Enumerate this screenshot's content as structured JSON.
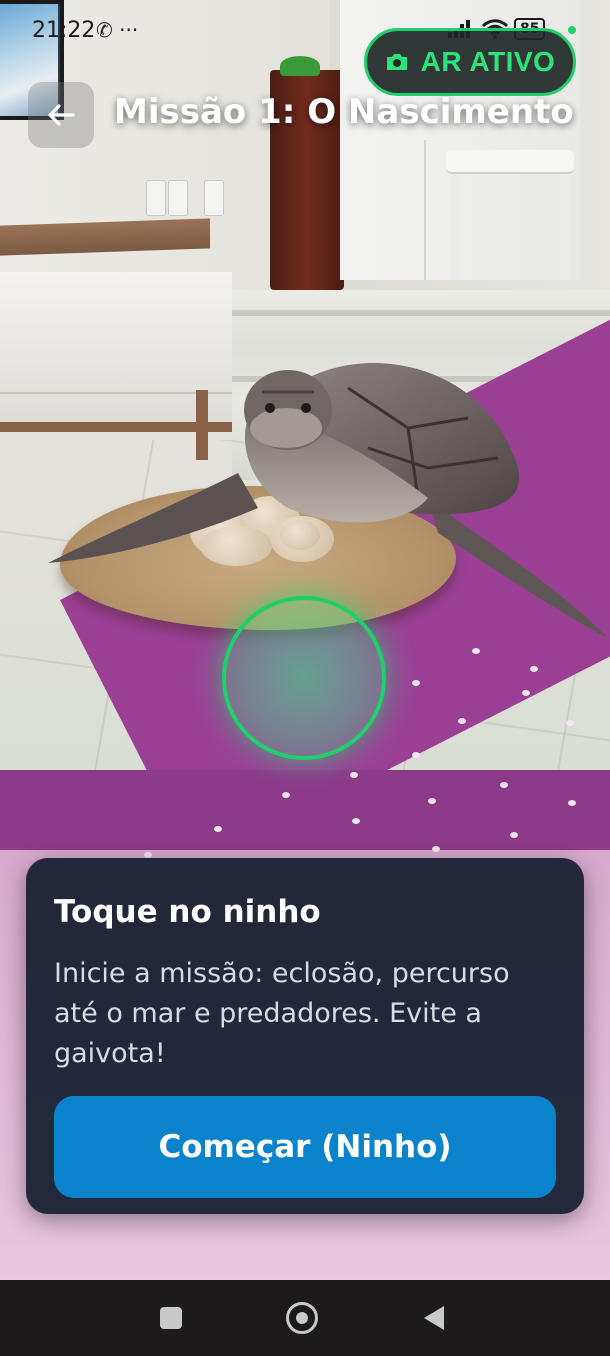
{
  "status_bar": {
    "time": "21:22",
    "left_icons": "✆ ···",
    "battery": "85"
  },
  "ar_badge": {
    "label": "AR ATIVO",
    "color": "#1fd06a",
    "icon": "camera-icon"
  },
  "header": {
    "title": "Missão 1: O Nascimento",
    "back_icon": "arrow-left-icon"
  },
  "mission_card": {
    "title": "Toque no ninho",
    "description": "Inicie a missão: eclosão, percurso até o mar e predadores. Evite a gaivota!",
    "button_label": "Começar (Ninho)",
    "button_color": "#0a82cc"
  },
  "nav_bar": {
    "icons": [
      "recents-square-icon",
      "home-circle-icon",
      "back-triangle-icon"
    ]
  }
}
